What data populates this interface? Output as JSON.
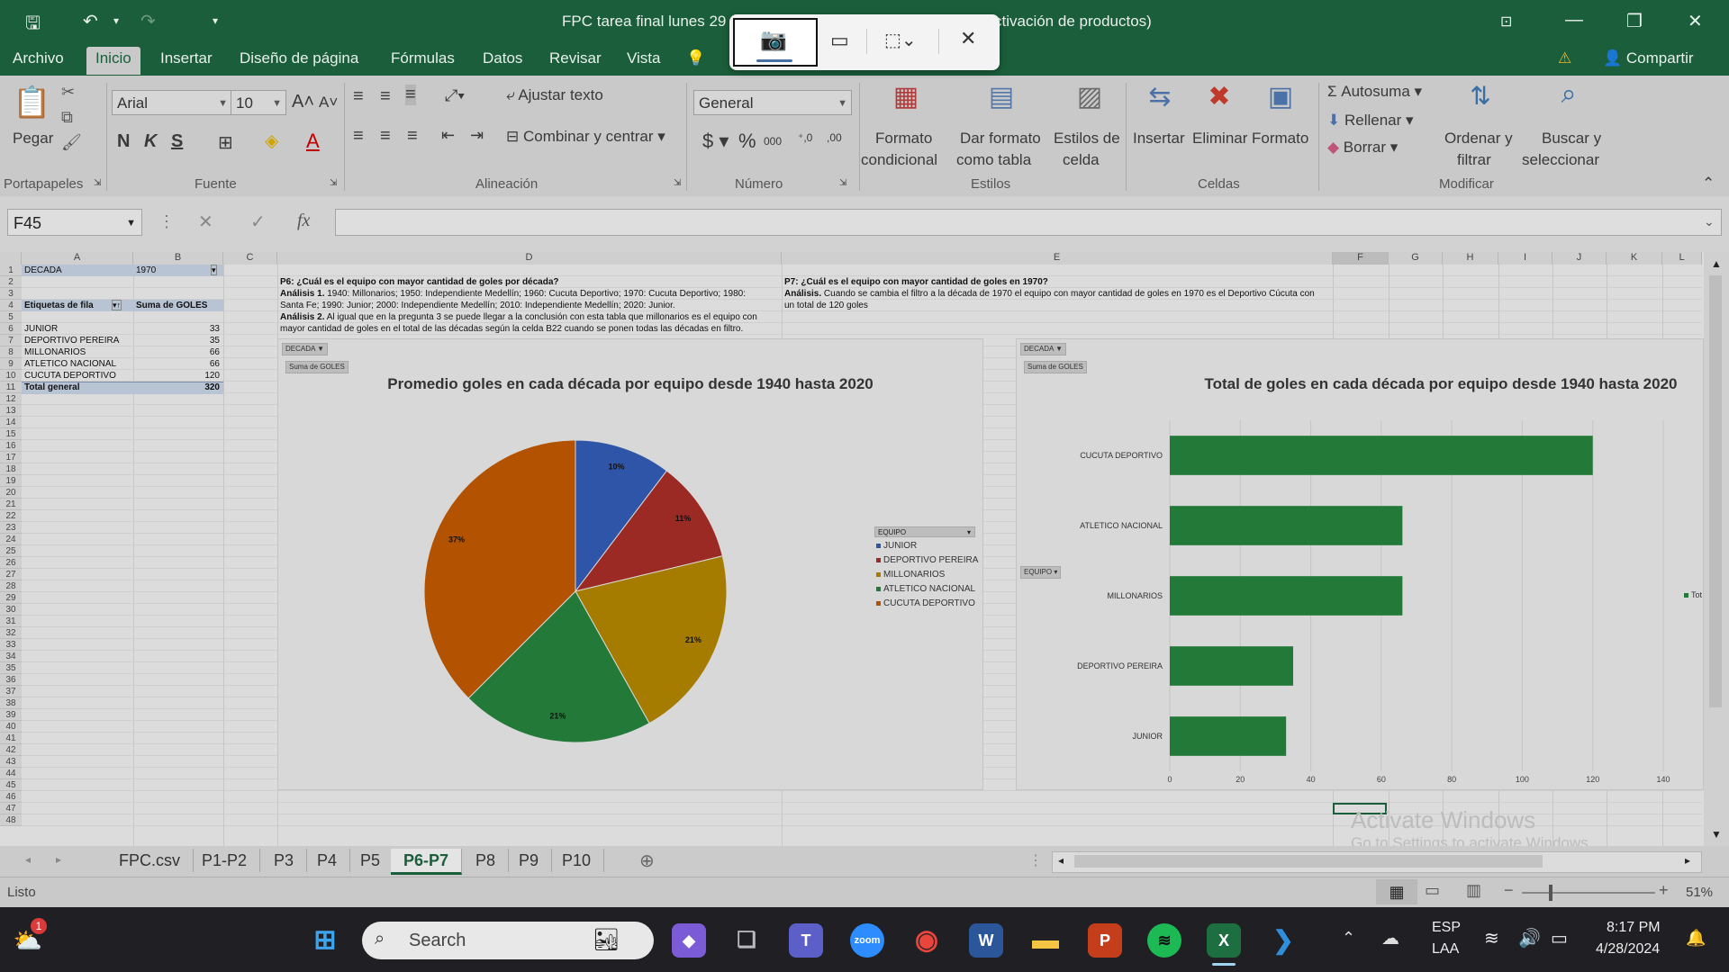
{
  "window": {
    "title": "FPC tarea final lunes 29",
    "title_right": "ctivación de productos)"
  },
  "tabs": [
    {
      "label": "Archivo"
    },
    {
      "label": "Inicio"
    },
    {
      "label": "Insertar"
    },
    {
      "label": "Diseño de página"
    },
    {
      "label": "Fórmulas"
    },
    {
      "label": "Datos"
    },
    {
      "label": "Revisar"
    },
    {
      "label": "Vista"
    }
  ],
  "share_label": "Compartir",
  "ribbon": {
    "paste": "Pegar",
    "font_name": "Arial",
    "font_size": "10",
    "bold": "N",
    "italic": "K",
    "underline": "S",
    "wrap_text": "Ajustar texto",
    "merge_center": "Combinar y centrar",
    "number_format": "General",
    "cond_format_1": "Formato",
    "cond_format_2": "condicional",
    "table_format_1": "Dar formato",
    "table_format_2": "como tabla",
    "cell_styles_1": "Estilos de",
    "cell_styles_2": "celda",
    "insert": "Insertar",
    "delete": "Eliminar",
    "format": "Formato",
    "autosum": "Autosuma",
    "fill": "Rellenar",
    "clear": "Borrar",
    "sort_1": "Ordenar y",
    "sort_2": "filtrar",
    "find_1": "Buscar y",
    "find_2": "seleccionar",
    "groups": {
      "clipboard": "Portapapeles",
      "font": "Fuente",
      "alignment": "Alineación",
      "number": "Número",
      "styles": "Estilos",
      "cells": "Celdas",
      "editing": "Modificar"
    }
  },
  "namebox": "F45",
  "columns": [
    "A",
    "B",
    "C",
    "D",
    "E",
    "F",
    "G",
    "H",
    "I",
    "J",
    "K",
    "L"
  ],
  "pivot": {
    "filter_label": "DECADA",
    "filter_value": "1970",
    "row_label_header": "Etiquetas de fila",
    "sum_header": "Suma de GOLES",
    "rows": [
      {
        "team": "JUNIOR",
        "goals": "33"
      },
      {
        "team": "DEPORTIVO PEREIRA",
        "goals": "35"
      },
      {
        "team": "MILLONARIOS",
        "goals": "66"
      },
      {
        "team": "ATLETICO NACIONAL",
        "goals": "66"
      },
      {
        "team": "CUCUTA DEPORTIVO",
        "goals": "120"
      }
    ],
    "total_label": "Total general",
    "total_value": "320"
  },
  "notes": {
    "p6_title": "P6: ¿Cuál es el equipo con mayor cantidad de goles por década?",
    "p6_a1_label": "Análisis 1.",
    "p6_a1_text": " 1940: Millonarios; 1950: Independiente Medellín; 1960: Cucuta Deportivo; 1970: Cucuta Deportivo; 1980:",
    "p6_a1_text2": "Santa Fe; 1990: Junior; 2000: Independiente Medellín; 2010: Independiente Medellín; 2020: Junior.",
    "p6_a2_label": "Análisis 2.",
    "p6_a2_text": " Al igual que en la pregunta 3 se puede llegar a la conclusión con esta tabla que millonarios es el equipo con",
    "p6_a2_text2": "mayor cantidad de goles en el total de las décadas según la celda B22 cuando se ponen todas las décadas en filtro.",
    "p7_title": "P7: ¿Cuál es el equipo con mayor cantidad de goles en 1970?",
    "p7_label": "Análisis.",
    "p7_text": "  Cuando se cambia el filtro a la década de 1970 el equipo con mayor cantidad de goles en 1970 es el Deportivo Cúcuta con",
    "p7_text2": "un total de 120 goles"
  },
  "chart_data": [
    {
      "type": "pie",
      "title": "Promedio goles en cada década por equipo desde 1940 hasta 2020",
      "filter_button": "DECADA",
      "value_button": "Suma de GOLES",
      "legend_header": "EQUIPO",
      "categories": [
        "JUNIOR",
        "DEPORTIVO PEREIRA",
        "MILLONARIOS",
        "ATLETICO NACIONAL",
        "CUCUTA DEPORTIVO"
      ],
      "values": [
        33,
        35,
        66,
        66,
        120
      ],
      "labels": [
        "10%",
        "11%",
        "21%",
        "21%",
        "37%"
      ],
      "colors": [
        "#2e55a8",
        "#9b2a24",
        "#a67c00",
        "#237a38",
        "#b35200"
      ],
      "legend_position": "right"
    },
    {
      "type": "bar",
      "title": "Total de goles en cada década por equipo desde 1940 hasta 2020",
      "filter_button": "DECADA",
      "value_button": "Suma de GOLES",
      "axis_button": "EQUIPO",
      "categories": [
        "CUCUTA DEPORTIVO",
        "ATLETICO NACIONAL",
        "MILLONARIOS",
        "DEPORTIVO PEREIRA",
        "JUNIOR"
      ],
      "values": [
        120,
        66,
        66,
        35,
        33
      ],
      "xlim": [
        0,
        140
      ],
      "xticks": [
        "0",
        "20",
        "40",
        "60",
        "80",
        "100",
        "120",
        "140"
      ],
      "color": "#237a38",
      "legend_text": "Tot"
    }
  ],
  "sheets": [
    {
      "name": "FPC.csv"
    },
    {
      "name": "P1-P2"
    },
    {
      "name": "P3"
    },
    {
      "name": "P4"
    },
    {
      "name": "P5"
    },
    {
      "name": "P6-P7"
    },
    {
      "name": "P8"
    },
    {
      "name": "P9"
    },
    {
      "name": "P10"
    }
  ],
  "status": {
    "ready": "Listo",
    "zoom": "51%"
  },
  "watermark": {
    "line1": "Activate Windows",
    "line2": "Go to Settings to activate Windows."
  },
  "taskbar": {
    "search": "Search",
    "lang1": "ESP",
    "lang2": "LAA",
    "time": "8:17 PM",
    "date": "4/28/2024",
    "badge": "1"
  },
  "colors": {
    "excel_green": "#1b5e3b"
  }
}
